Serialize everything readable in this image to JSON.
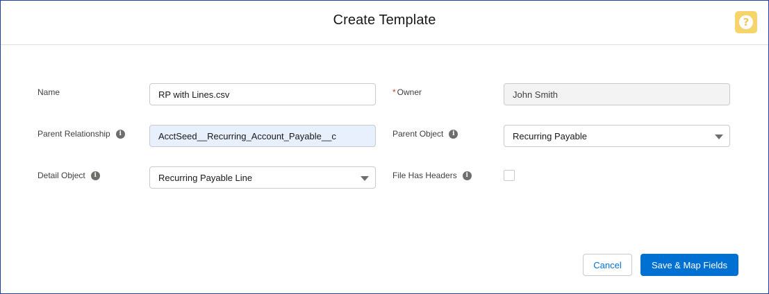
{
  "header": {
    "title": "Create Template",
    "help_icon": "help-icon"
  },
  "form": {
    "name": {
      "label": "Name",
      "value": "RP with Lines.csv"
    },
    "owner": {
      "required_mark": "*",
      "label": "Owner",
      "value": "John Smith"
    },
    "parent_relationship": {
      "label": "Parent Relationship",
      "value": "AcctSeed__Recurring_Account_Payable__c"
    },
    "parent_object": {
      "label": "Parent Object",
      "value": "Recurring Payable"
    },
    "detail_object": {
      "label": "Detail Object",
      "value": "Recurring Payable Line"
    },
    "file_has_headers": {
      "label": "File Has Headers",
      "checked": false
    }
  },
  "footer": {
    "cancel_label": "Cancel",
    "save_label": "Save & Map Fields"
  },
  "colors": {
    "brand": "#0070d2",
    "help": "#f5d46c",
    "required": "#c23934"
  }
}
